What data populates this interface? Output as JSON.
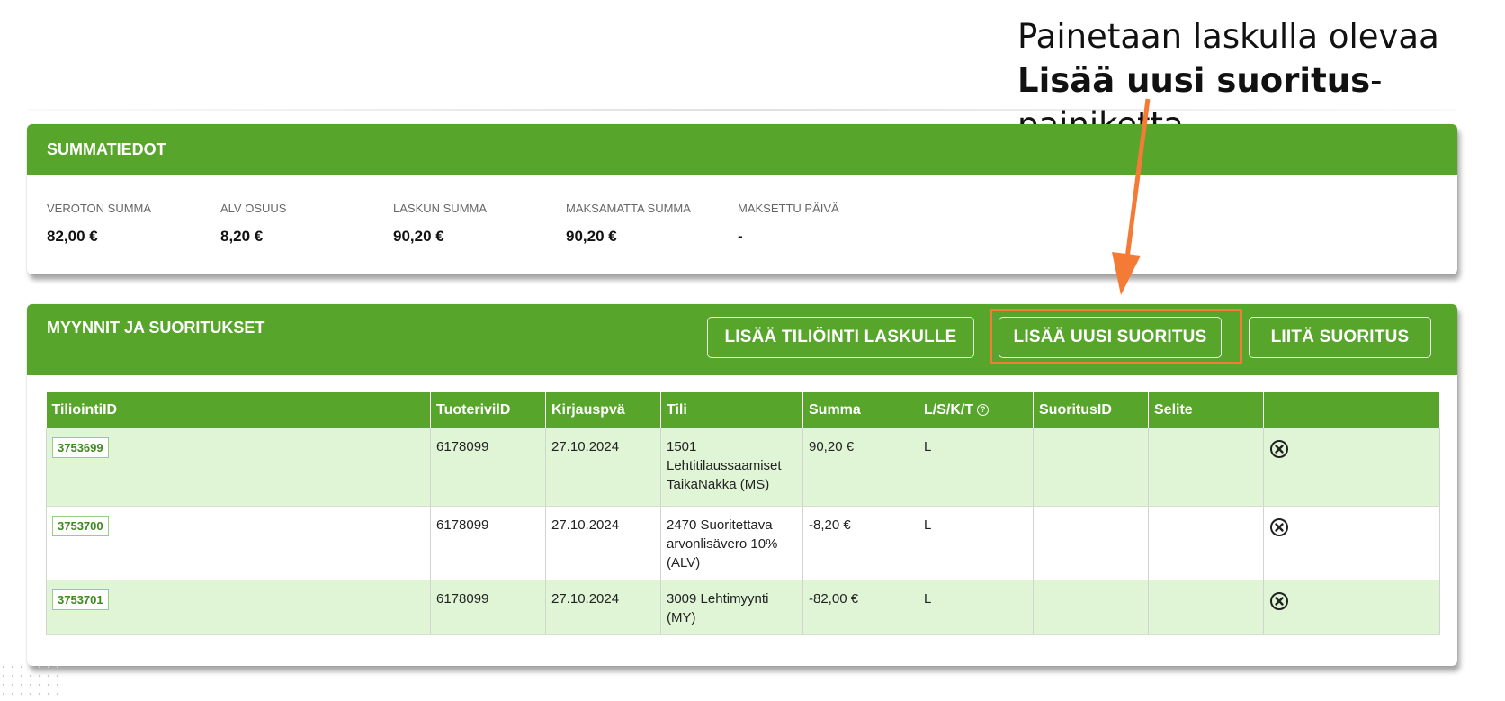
{
  "annotation": {
    "line1": "Painetaan laskulla olevaa",
    "bold": "Lisää uusi suoritus",
    "rest": "-painiketta",
    "color": "#f47b35"
  },
  "summary": {
    "title": "SUMMATIEDOT",
    "items": [
      {
        "label": "VEROTON SUMMA",
        "value": "82,00 €"
      },
      {
        "label": "ALV OSUUS",
        "value": "8,20 €"
      },
      {
        "label": "LASKUN SUMMA",
        "value": "90,20 €"
      },
      {
        "label": "MAKSAMATTA SUMMA",
        "value": "90,20 €"
      },
      {
        "label": "MAKSETTU PÄIVÄ",
        "value": "-"
      }
    ]
  },
  "sales": {
    "title": "MYYNNIT JA SUORITUKSET",
    "buttons": {
      "add_entry": "LISÄÄ TILIÖINTI LASKULLE",
      "add_payment": "LISÄÄ UUSI SUORITUS",
      "attach_payment": "LIITÄ SUORITUS"
    },
    "columns": [
      "TiliointiID",
      "TuoterivilD",
      "Kirjauspvä",
      "Tili",
      "Summa",
      "L/S/K/T",
      "SuoritusID",
      "Selite",
      ""
    ],
    "help_icon": "?",
    "rows": [
      {
        "id": "3753699",
        "tuoterivi": "6178099",
        "pvm": "27.10.2024",
        "tili": "1501 Lehtitilaussaamiset TaikaNakka (MS)",
        "summa": "90,20 €",
        "lskt": "L",
        "suoritus": "",
        "selite": ""
      },
      {
        "id": "3753700",
        "tuoterivi": "6178099",
        "pvm": "27.10.2024",
        "tili": "2470 Suoritettava arvonlisävero 10% (ALV)",
        "summa": "-8,20 €",
        "lskt": "L",
        "suoritus": "",
        "selite": ""
      },
      {
        "id": "3753701",
        "tuoterivi": "6178099",
        "pvm": "27.10.2024",
        "tili": "3009 Lehtimyynti (MY)",
        "summa": "-82,00 €",
        "lskt": "L",
        "suoritus": "",
        "selite": ""
      }
    ]
  },
  "colors": {
    "header_green": "#58a52c",
    "row_green": "#dff5d6",
    "highlight_orange": "#f47b35"
  },
  "icons": {
    "delete": "circle-x-icon",
    "help": "question-circle-icon"
  }
}
